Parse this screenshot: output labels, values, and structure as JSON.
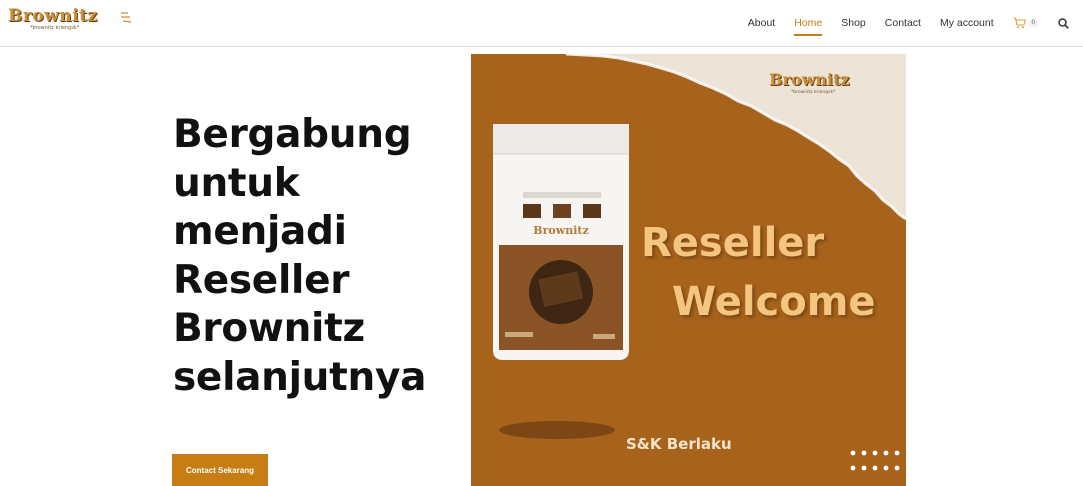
{
  "brand": {
    "name": "Brownitz",
    "tagline": "*brownitz kriengsk*"
  },
  "nav": {
    "items": [
      {
        "label": "About",
        "active": false
      },
      {
        "label": "Home",
        "active": true
      },
      {
        "label": "Shop",
        "active": false
      },
      {
        "label": "Contact",
        "active": false
      },
      {
        "label": "My account",
        "active": false
      }
    ],
    "cart_count": "0",
    "cart_icon": "cart-icon",
    "search_icon": "search-icon"
  },
  "hero": {
    "heading": "Bergabung untuk menjadi Reseller Brownitz selanjutnya",
    "cta_label": "Contact Sekarang"
  },
  "banner": {
    "line1": "Reseller",
    "line2": "Welcome",
    "terms": "S&K Berlaku",
    "logo_text": "Brownitz",
    "logo_tagline": "*brownitz kriengsk*",
    "package_brand": "Brownitz"
  },
  "colors": {
    "accent": "#c77c14",
    "banner_bg": "#a7631c",
    "banner_text": "#f3c57f",
    "paper": "#ede3d6"
  }
}
